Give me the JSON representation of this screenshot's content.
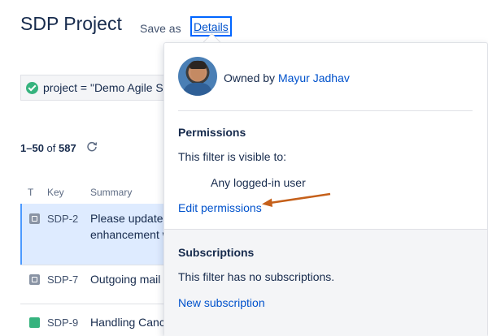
{
  "header": {
    "title": "SDP Project",
    "save_as_label": "Save as",
    "details_label": "Details"
  },
  "query": {
    "text": "project = \"Demo Agile S"
  },
  "results": {
    "range": "1–50",
    "of_label": "of",
    "total": "587"
  },
  "table": {
    "columns": [
      "T",
      "Key",
      "Summary"
    ],
    "rows": [
      {
        "type": "task",
        "key": "SDP-2",
        "summary_line1": "Please update",
        "summary_line2": "enhancement w"
      },
      {
        "type": "task",
        "key": "SDP-7",
        "summary_line1": "Outgoing mail"
      },
      {
        "type": "story",
        "key": "SDP-9",
        "summary_line1": "Handling Canc"
      }
    ]
  },
  "details_panel": {
    "owned_by_label": "Owned by",
    "owner_name": "Mayur Jadhav",
    "permissions": {
      "title": "Permissions",
      "visible_text": "This filter is visible to:",
      "audience": "Any logged-in user",
      "edit_link": "Edit permissions"
    },
    "subscriptions": {
      "title": "Subscriptions",
      "none_text": "This filter has no subscriptions.",
      "new_link": "New subscription"
    }
  },
  "colors": {
    "link": "#0052cc",
    "focus_ring": "#0065ff",
    "annotation_arrow": "#c5601a",
    "selected_row": "#deebff",
    "success": "#36b37e"
  }
}
